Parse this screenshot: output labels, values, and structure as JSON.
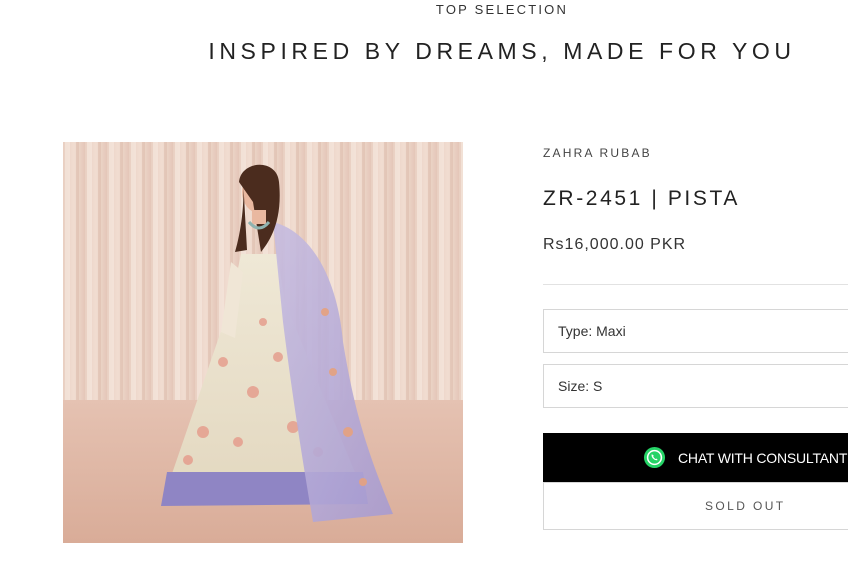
{
  "section": {
    "eyebrow": "TOP SELECTION",
    "headline": "INSPIRED BY DREAMS, MADE FOR YOU"
  },
  "product": {
    "vendor": "ZAHRA RUBAB",
    "title": "ZR-2451 | PISTA",
    "price": "Rs16,000.00 PKR",
    "image_icon": "product-photo"
  },
  "options": {
    "type_label": "Type: Maxi",
    "size_label": "Size: S"
  },
  "actions": {
    "chat_label": "CHAT WITH CONSULTANT",
    "chat_icon": "whatsapp-icon",
    "sold_out_label": "SOLD OUT"
  },
  "colors": {
    "button_bg": "#000000",
    "whatsapp_green": "#25D366"
  }
}
